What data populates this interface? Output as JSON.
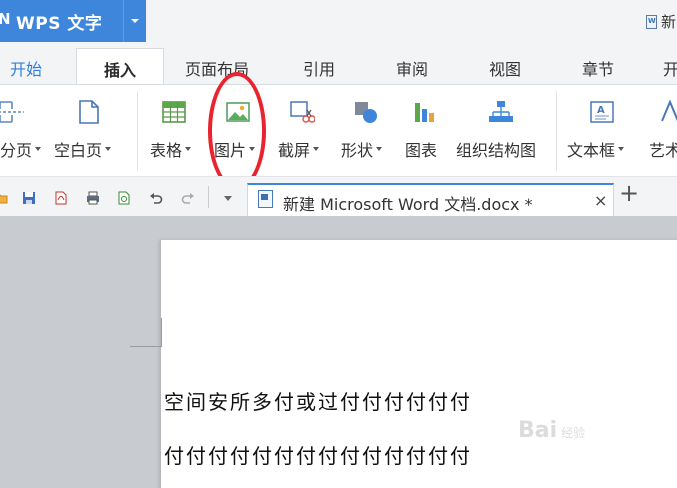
{
  "app": {
    "logo_edge": "N",
    "name": "WPS 文字",
    "title_right": "新"
  },
  "menu_tabs": [
    {
      "label": "开始"
    },
    {
      "label": "插入"
    },
    {
      "label": "页面布局"
    },
    {
      "label": "引用"
    },
    {
      "label": "审阅"
    },
    {
      "label": "视图"
    },
    {
      "label": "章节"
    },
    {
      "label": "开"
    }
  ],
  "ribbon": {
    "page_break": "分页",
    "blank_page": "空白页",
    "table": "表格",
    "picture": "图片",
    "screenshot": "截屏",
    "shape": "形状",
    "chart": "图表",
    "org_chart": "组织结构图",
    "text_box": "文本框",
    "art": "艺术"
  },
  "document_tab": {
    "title": "新建 Microsoft Word 文档.docx *",
    "close": "×",
    "new_tab": "+"
  },
  "document": {
    "line1": "空间安所多付或过付付付付付付",
    "line2": "付付付付付付付付付付付付付付"
  },
  "watermark": {
    "brand": "Bai",
    "suffix": "经验"
  },
  "colors": {
    "accent": "#3e86dc",
    "highlight": "#e8242e"
  }
}
